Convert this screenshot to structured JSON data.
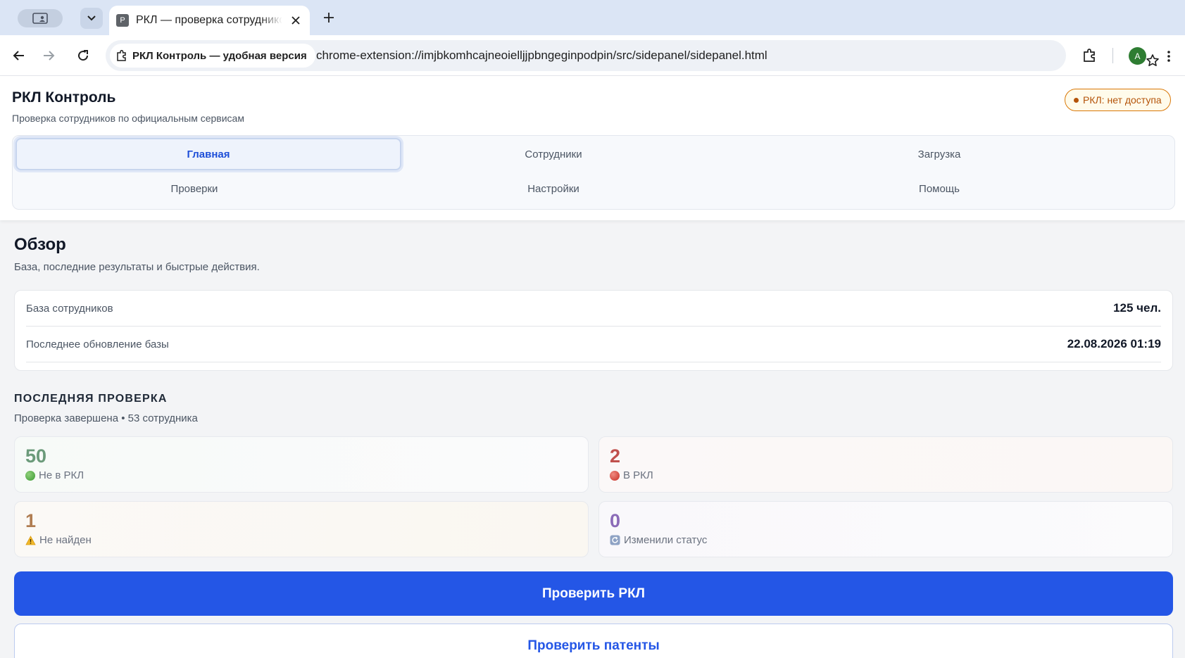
{
  "browser": {
    "tab": {
      "favicon_letter": "Р",
      "title": "РКЛ — проверка сотрудников"
    },
    "site_chip": "РКЛ Контроль — удобная версия",
    "url": "chrome-extension://imjbkomhcajneoielljjpbngeginpodpin/src/sidepanel/sidepanel.html",
    "avatar_letter": "A"
  },
  "header": {
    "title": "РКЛ Контроль",
    "subtitle": "Проверка сотрудников по официальным сервисам",
    "access_badge": "РКЛ: нет доступа"
  },
  "nav": {
    "tabs": [
      {
        "label": "Главная",
        "active": true
      },
      {
        "label": "Сотрудники"
      },
      {
        "label": "Загрузка"
      },
      {
        "label": "Проверки"
      },
      {
        "label": "Настройки"
      },
      {
        "label": "Помощь"
      }
    ]
  },
  "overview": {
    "title": "Обзор",
    "subtitle": "База, последние результаты и быстрые действия.",
    "stats": [
      {
        "label": "База сотрудников",
        "value": "125 чел."
      },
      {
        "label": "Последнее обновление базы",
        "value": "22.08.2026 01:19"
      }
    ]
  },
  "last_check": {
    "heading": "ПОСЛЕДНЯЯ ПРОВЕРКА",
    "meta": "Проверка завершена • 53 сотрудника",
    "results": [
      {
        "value": "50",
        "label": "Не в РКЛ",
        "icon": "green-circle-icon",
        "color": "#6b9a7a"
      },
      {
        "value": "2",
        "label": "В РКЛ",
        "icon": "red-circle-icon",
        "color": "#c0504d"
      },
      {
        "value": "1",
        "label": "Не найден",
        "icon": "warning-icon",
        "color": "#b07d52"
      },
      {
        "value": "0",
        "label": "Изменили статус",
        "icon": "refresh-icon",
        "color": "#8b6bb8"
      }
    ]
  },
  "actions": {
    "primary": "Проверить РКЛ",
    "secondary": "Проверить патенты"
  },
  "colors": {
    "accent": "#2456e6",
    "badge": "#b45309"
  }
}
